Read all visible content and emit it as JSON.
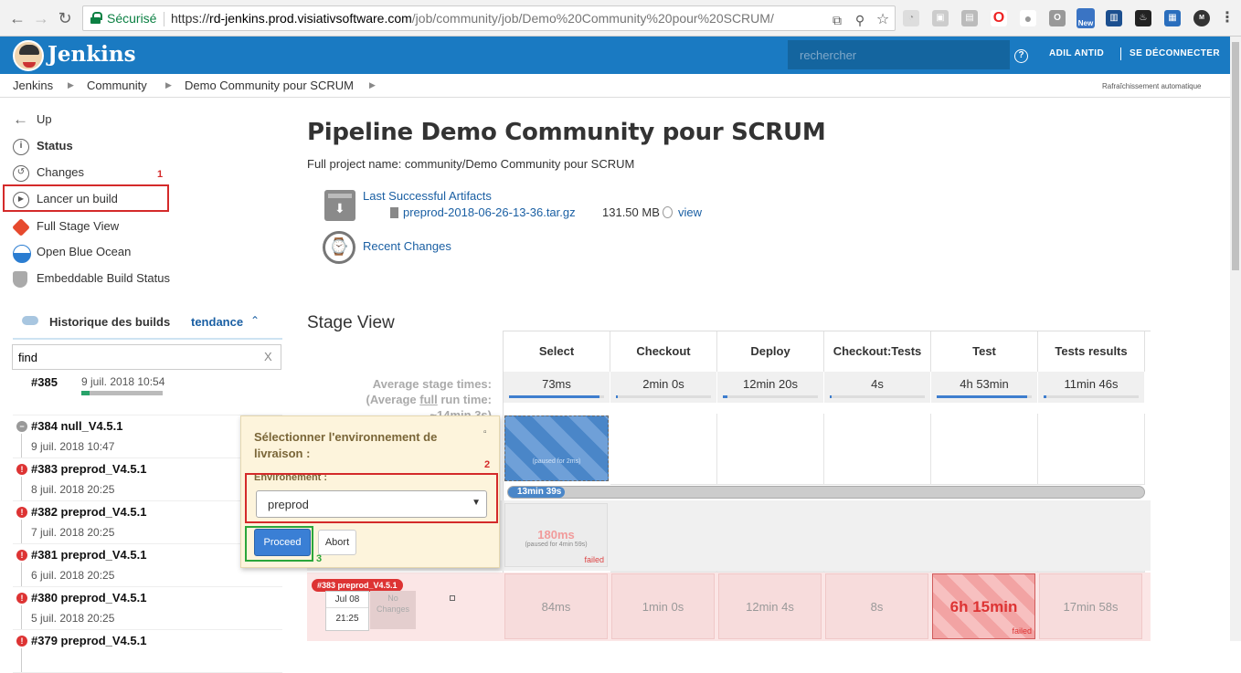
{
  "browser": {
    "secure_label": "Sécurisé",
    "url_scheme": "https://",
    "url_host": "rd-jenkins.prod.visiativsoftware.com",
    "url_path": "/job/community/job/Demo%20Community%20pour%20SCRUM/",
    "new_badge": "New"
  },
  "header": {
    "brand": "Jenkins",
    "search_placeholder": "rechercher",
    "help": "?",
    "user": "ADIL ANTID",
    "logout": "SE DÉCONNECTER"
  },
  "breadcrumb": {
    "items": [
      "Jenkins",
      "Community",
      "Demo Community pour SCRUM"
    ],
    "auto_refresh": "Rafraîchissement automatique"
  },
  "sidebar": {
    "items": [
      {
        "label": "Up",
        "icon": "arrow-left-icon"
      },
      {
        "label": "Status",
        "icon": "info-icon"
      },
      {
        "label": "Changes",
        "icon": "history-icon"
      },
      {
        "label": "Lancer un build",
        "icon": "play-icon"
      },
      {
        "label": "Full Stage View",
        "icon": "git-icon"
      },
      {
        "label": "Open Blue Ocean",
        "icon": "blue-ocean-icon"
      },
      {
        "label": "Embeddable Build Status",
        "icon": "shield-icon"
      }
    ],
    "history_title": "Historique des builds",
    "trend": "tendance",
    "find_value": "find",
    "find_clear": "X",
    "builds": [
      {
        "num": "#385",
        "date": "9 juil. 2018 10:54",
        "status": "running",
        "progress": 0.1
      },
      {
        "num": "#384 null_V4.5.1",
        "date": "9 juil. 2018 10:47",
        "status": "aborted"
      },
      {
        "num": "#383 preprod_V4.5.1",
        "date": "8 juil. 2018 20:25",
        "status": "failed"
      },
      {
        "num": "#382 preprod_V4.5.1",
        "date": "7 juil. 2018 20:25",
        "status": "failed"
      },
      {
        "num": "#381 preprod_V4.5.1",
        "date": "6 juil. 2018 20:25",
        "status": "failed"
      },
      {
        "num": "#380 preprod_V4.5.1",
        "date": "5 juil. 2018 20:25",
        "status": "failed"
      },
      {
        "num": "#379 preprod_V4.5.1",
        "date": "",
        "status": "failed"
      }
    ]
  },
  "main": {
    "title": "Pipeline Demo Community pour SCRUM",
    "full_name": "Full project name: community/Demo Community pour SCRUM",
    "artifacts_label": "Last Successful Artifacts",
    "artifact_file": "preprod-2018-06-26-13-36.tar.gz",
    "artifact_size": "131.50 MB",
    "artifact_view": "view",
    "recent_changes": "Recent Changes",
    "stage_view": "Stage View"
  },
  "stage": {
    "avg_label": "Average stage times:",
    "avg_full_a": "(Average ",
    "avg_full_b": "full",
    "avg_full_c": " run time:",
    "avg_full_d": "~14min 3s)",
    "columns": [
      {
        "name": "Select",
        "avg": "73ms",
        "bar": 0.95
      },
      {
        "name": "Checkout",
        "avg": "2min 0s",
        "bar": 0.02
      },
      {
        "name": "Deploy",
        "avg": "12min 20s",
        "bar": 0.05
      },
      {
        "name": "Checkout:Tests",
        "avg": "4s",
        "bar": 0.02
      },
      {
        "name": "Test",
        "avg": "4h 53min",
        "bar": 0.95
      },
      {
        "name": "Tests results",
        "avg": "11min 46s",
        "bar": 0.03
      }
    ],
    "running_paused": "(paused for 2ms)",
    "running_bar": "13min 39s",
    "row2_select": "180ms",
    "row2_paused": "(paused for 4min 59s)",
    "row2_failed": "failed",
    "row3_badge": "#383 preprod_V4.5.1",
    "row3_month": "Jul 08",
    "row3_time": "21:25",
    "row3_nochanges": "No Changes",
    "row3_cells": [
      "84ms",
      "1min 0s",
      "12min 4s",
      "8s",
      "6h 15min",
      "17min 58s"
    ],
    "row3_failed": "failed"
  },
  "popup": {
    "title": "Sélectionner l'environnement de livraison :",
    "env_label": "Environement :",
    "env_value": "preprod",
    "proceed": "Proceed",
    "abort": "Abort",
    "close": "▫"
  },
  "annotations": {
    "one": "1",
    "two": "2",
    "three": "3"
  },
  "colors": {
    "jenkins_blue": "#1a7ac2",
    "annotation_red": "#d42a2a",
    "annotation_green": "#2aa63a",
    "failed_bg": "#f7dcdc"
  }
}
